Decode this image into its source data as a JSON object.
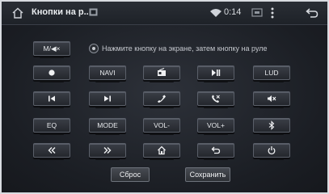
{
  "status_bar": {
    "title": "Кнопки на р...",
    "time": "0:14"
  },
  "hint": "Нажмите кнопку на экране, затем кнопку на руле",
  "mode_button_label": "M/◀×",
  "buttons": {
    "navi": "NAVI",
    "lud": "LUD",
    "eq": "EQ",
    "mode": "MODE",
    "vol_down": "VOL-",
    "vol_up": "VOL+"
  },
  "actions": {
    "reset": "Сброс",
    "save": "Сохранить"
  },
  "colors": {
    "background": "#16181d",
    "status_bar": "#1e2228",
    "button": "#2e3238",
    "text": "#e6e8eb"
  }
}
